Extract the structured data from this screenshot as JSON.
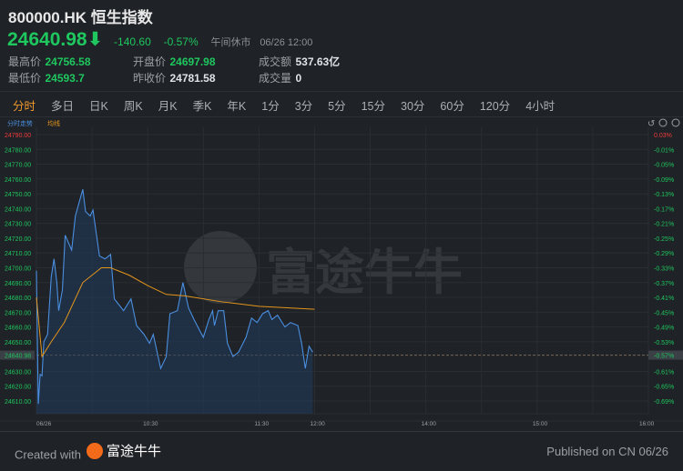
{
  "header": {
    "title": "800000.HK 恒生指数",
    "price": "24640.98",
    "change": "-140.60",
    "change_pct": "-0.57%",
    "status": "午间休市",
    "datetime": "06/26 12:00"
  },
  "stats": [
    {
      "label": "最高价",
      "value": "24756.58",
      "color": "green"
    },
    {
      "label": "最低价",
      "value": "24593.7",
      "color": "green"
    },
    {
      "label": "开盘价",
      "value": "24697.98",
      "color": "green"
    },
    {
      "label": "昨收价",
      "value": "24781.58",
      "color": "white"
    },
    {
      "label": "成交额",
      "value": "537.63亿",
      "color": "white"
    },
    {
      "label": "成交量",
      "value": "0",
      "color": "white"
    }
  ],
  "tabs": [
    "分时",
    "多日",
    "日K",
    "周K",
    "月K",
    "季K",
    "年K",
    "1分",
    "3分",
    "5分",
    "15分",
    "30分",
    "60分",
    "120分",
    "4小时"
  ],
  "active_tab": 0,
  "legend": {
    "price": "分时走势",
    "avg": "均线"
  },
  "colors": {
    "up": "#ef3b3b",
    "down": "#1fc75f",
    "price_line": "#4a8fe0",
    "avg_line": "#e3961c",
    "bg": "#1f2226"
  },
  "chart_data": {
    "type": "line",
    "title": "分时走势",
    "ylim": [
      24610,
      24790
    ],
    "left_ticks": [
      "24790.00",
      "24780.00",
      "24770.00",
      "24760.00",
      "24750.00",
      "24740.00",
      "24730.00",
      "24720.00",
      "24710.00",
      "24700.00",
      "24690.00",
      "24680.00",
      "24670.00",
      "24660.00",
      "24650.00",
      "24640.98",
      "24630.00",
      "24620.00",
      "24610.00"
    ],
    "right_ticks": [
      "0.03%",
      "-0.01%",
      "-0.05%",
      "-0.09%",
      "-0.13%",
      "-0.17%",
      "-0.21%",
      "-0.25%",
      "-0.29%",
      "-0.33%",
      "-0.37%",
      "-0.41%",
      "-0.45%",
      "-0.49%",
      "-0.53%",
      "-0.57%",
      "-0.61%",
      "-0.65%",
      "-0.69%"
    ],
    "current": 24640.98,
    "x_ticks": [
      {
        "label": "06/26",
        "min": 0
      },
      {
        "label": "10:30",
        "min": 60
      },
      {
        "label": "11:30",
        "min": 120
      },
      {
        "label": "12:00",
        "min": 150
      },
      {
        "label": "14:00",
        "min": 210
      },
      {
        "label": "15:00",
        "min": 270
      },
      {
        "label": "16:00",
        "min": 330
      }
    ],
    "total_minutes": 330,
    "price": {
      "name": "分时走势",
      "minutes": [
        0,
        1,
        2,
        3,
        4,
        6,
        8,
        9.5,
        11,
        12,
        14,
        15.5,
        19,
        21,
        25,
        26.5,
        29,
        30.5,
        34,
        37,
        40,
        42,
        47,
        51,
        54,
        58,
        61,
        63,
        67,
        70,
        72,
        76,
        79,
        82,
        85,
        90,
        93,
        95,
        96,
        98,
        101,
        103,
        106,
        109,
        113,
        116,
        119,
        122,
        125,
        127,
        130,
        134,
        137,
        141,
        143,
        145,
        147,
        149
      ],
      "values": [
        24698,
        24608,
        24628,
        24627,
        24650,
        24655,
        24694,
        24706,
        24690,
        24671,
        24685,
        24722,
        24712,
        24735,
        24753,
        24738,
        24735,
        24739,
        24708,
        24706,
        24709,
        24679,
        24671,
        24679,
        24661,
        24655,
        24649,
        24655,
        24632,
        24640,
        24669,
        24671,
        24690,
        24673,
        24665,
        24653,
        24665,
        24671,
        24661,
        24671,
        24671,
        24649,
        24640,
        24643,
        24653,
        24666,
        24663,
        24669,
        24671,
        24665,
        24668,
        24660,
        24663,
        24661,
        24649,
        24632,
        24647,
        24643
      ]
    },
    "avg": {
      "name": "均线",
      "minutes": [
        0,
        3,
        8,
        15,
        25,
        35,
        40,
        50,
        60,
        70,
        80,
        100,
        120,
        150
      ],
      "values": [
        24680,
        24640,
        24650,
        24663,
        24690,
        24700,
        24700,
        24695,
        24688,
        24682,
        24681,
        24677,
        24674,
        24672
      ]
    }
  },
  "footer": {
    "created": "Created with",
    "brand": "富途牛牛",
    "published": "Published on CN 06/26"
  }
}
